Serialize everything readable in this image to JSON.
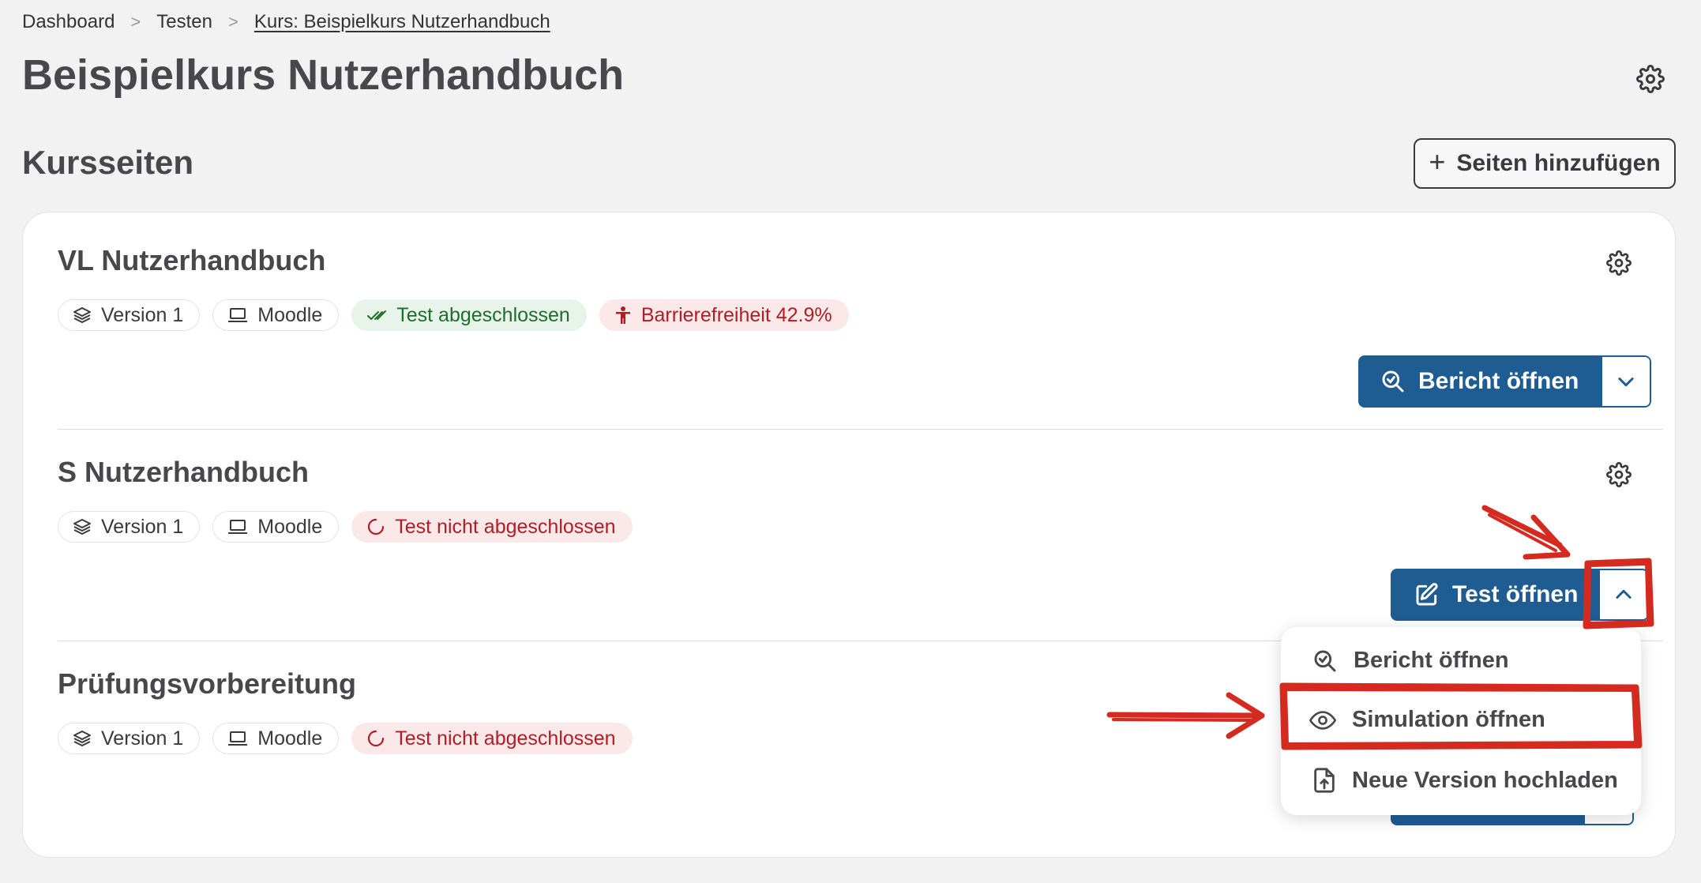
{
  "breadcrumb": {
    "items": [
      "Dashboard",
      "Testen"
    ],
    "current": "Kurs: Beispielkurs Nutzerhandbuch",
    "separator": ">"
  },
  "page": {
    "title": "Beispielkurs Nutzerhandbuch",
    "section_title": "Kursseiten",
    "add_button": "Seiten hinzufügen"
  },
  "courses": [
    {
      "title": "VL Nutzerhandbuch",
      "tags": [
        "Version 1",
        "Moodle",
        "Test abgeschlossen",
        "Barrierefreiheit 42.9%"
      ],
      "action": "Bericht öffnen"
    },
    {
      "title": "S Nutzerhandbuch",
      "tags": [
        "Version 1",
        "Moodle",
        "Test nicht abgeschlossen"
      ],
      "action": "Test öffnen"
    },
    {
      "title": "Prüfungsvorbereitung",
      "tags": [
        "Version 1",
        "Moodle",
        "Test nicht abgeschlossen"
      ]
    }
  ],
  "dropdown": {
    "items": [
      "Bericht öffnen",
      "Simulation öffnen",
      "Neue Version hochladen"
    ]
  },
  "colors": {
    "primary": "#1e5c91",
    "success_text": "#1e6e2b",
    "success_bg": "#e8f3ea",
    "danger_text": "#b21d24",
    "danger_bg": "#fbe9ea",
    "annotation": "#d42a1f"
  }
}
